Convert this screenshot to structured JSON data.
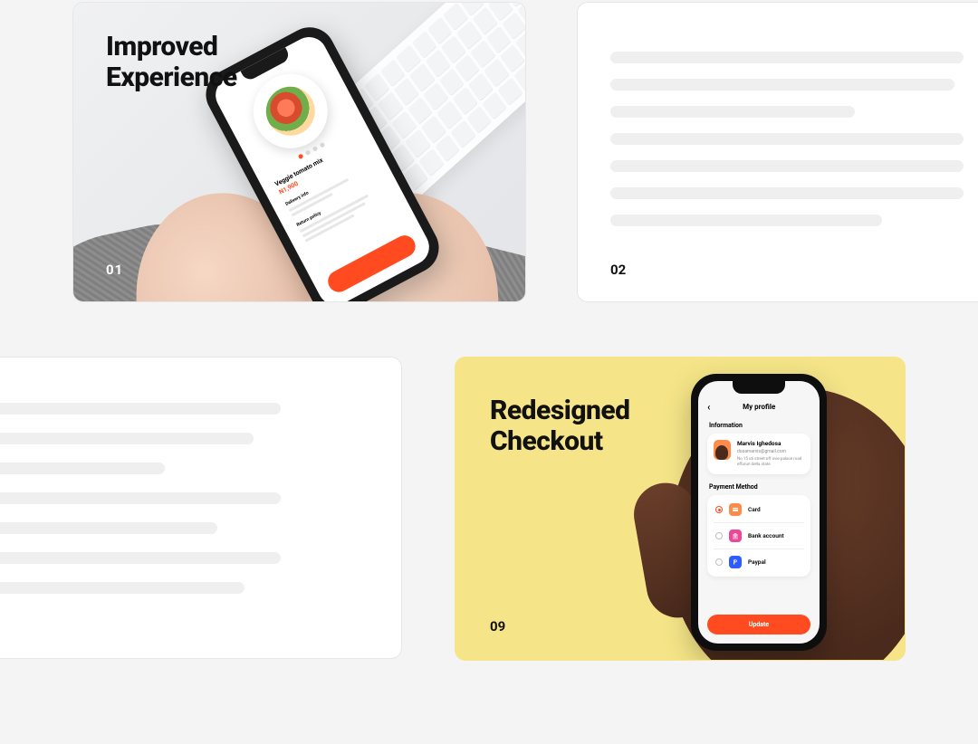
{
  "cards": {
    "c01": {
      "index": "01",
      "title": "Improved\nExperience"
    },
    "c02": {
      "index": "02"
    },
    "c09": {
      "index": "09",
      "title": "Redesigned\nCheckout"
    }
  },
  "phone_food": {
    "product_name": "Veggie tomato mix",
    "price": "N1,900",
    "section1_label": "Delivery info",
    "section2_label": "Return policy"
  },
  "phone_profile": {
    "screen_title": "My profile",
    "info_label": "Information",
    "user_name": "Marvis Ighedosa",
    "user_email": "dosamarvis@gmail.com",
    "user_desc": "No 15 uti street off ovie palace road effurun delta state",
    "pm_label": "Payment Method",
    "methods": {
      "card": {
        "label": "Card",
        "color": "#ff8b4a",
        "selected": true
      },
      "bank": {
        "label": "Bank account",
        "color": "#ec4899",
        "selected": false
      },
      "paypal": {
        "label": "Paypal",
        "color": "#2f5cff",
        "selected": false
      }
    },
    "cta": "Update"
  },
  "skeleton": {
    "c02_widths": [
      "390",
      "380",
      "270",
      "390",
      "390",
      "390",
      "300"
    ],
    "c03_widths": [
      "370",
      "340",
      "242",
      "370",
      "300",
      "370",
      "330"
    ]
  }
}
